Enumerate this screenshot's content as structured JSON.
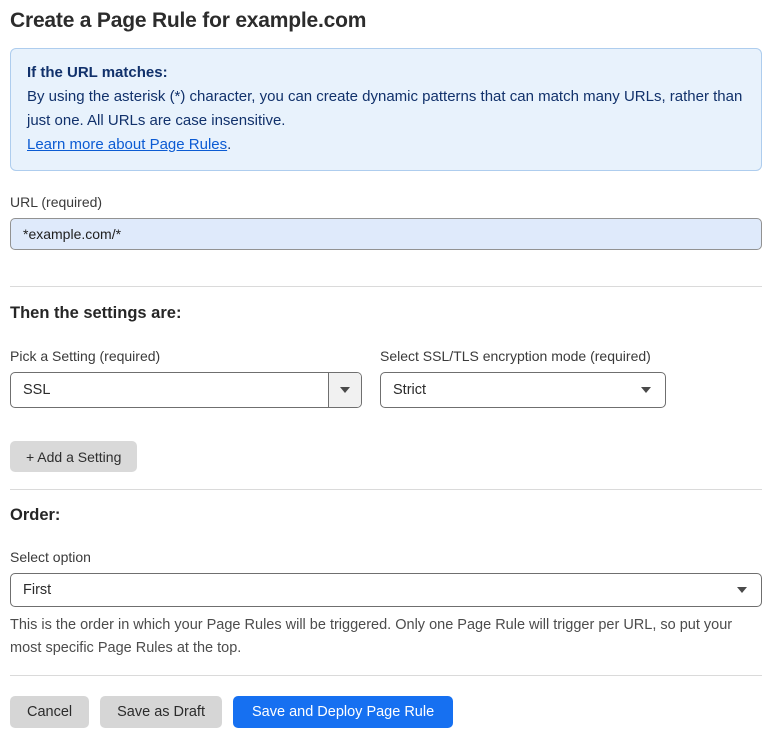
{
  "page": {
    "title": "Create a Page Rule for example.com"
  },
  "info_banner": {
    "heading": "If the URL matches:",
    "body": "By using the asterisk (*) character, you can create dynamic patterns that can match many URLs, rather than just one. All URLs are case insensitive.",
    "link_label": "Learn more about Page Rules",
    "link_suffix": "."
  },
  "url_field": {
    "label": "URL (required)",
    "value": "*example.com/*"
  },
  "settings_section": {
    "heading": "Then the settings are:",
    "setting_select": {
      "label": "Pick a Setting (required)",
      "value": "SSL"
    },
    "mode_select": {
      "label": "Select SSL/TLS encryption mode (required)",
      "value": "Strict"
    },
    "add_setting_label": "+ Add a Setting"
  },
  "order_section": {
    "heading": "Order:",
    "select_label": "Select option",
    "value": "First",
    "help_text": "This is the order in which your Page Rules will be triggered. Only one Page Rule will trigger per URL, so put your most specific Page Rules at the top."
  },
  "footer": {
    "cancel_label": "Cancel",
    "save_draft_label": "Save as Draft",
    "save_deploy_label": "Save and Deploy Page Rule"
  },
  "colors": {
    "accent_blue": "#1670f1",
    "info_background": "#e8f2fc",
    "info_border": "#aecdee",
    "info_text": "#11316b",
    "link_blue": "#0b5bd3",
    "input_fill_blue": "#dfeafb",
    "button_gray": "#d6d6d6",
    "divider_gray": "#dadada"
  }
}
